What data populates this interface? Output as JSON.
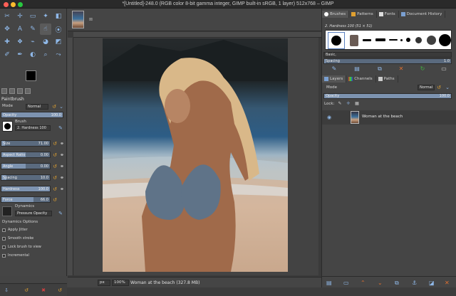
{
  "window": {
    "title": "*[Untitled]-248.0 (RGB color 8-bit gamma integer, GIMP built-in sRGB, 1 layer) 512x768 – GIMP",
    "traffic_colors": [
      "#ff5f57",
      "#febc2e",
      "#28c840"
    ]
  },
  "toolbox": {
    "tools": [
      "scissors-icon",
      "crosshair-icon",
      "rect-select-icon",
      "fuzzy-select-icon",
      "eraser-icon",
      "move-icon",
      "text-icon",
      "paintbrush-icon",
      "smudge-icon",
      "color-picker-icon",
      "heal-icon",
      "clone-icon",
      "warp-icon",
      "bucket-icon",
      "gradient-icon",
      "pencil-icon",
      "ink-icon",
      "dodge-icon",
      "zoom-icon",
      "path-icon"
    ],
    "glyphs": [
      "✂",
      "✛",
      "▭",
      "✦",
      "◧",
      "✥",
      "A",
      "✎",
      "☝",
      "⦿",
      "✚",
      "❖",
      "⌁",
      "◕",
      "◩",
      "✐",
      "✒",
      "◐",
      "⌕",
      "⤳"
    ],
    "active_index": 8
  },
  "tool_options": {
    "title": "Paintbrush",
    "mode_label": "Mode",
    "mode_value": "Normal",
    "opacity_label": "Opacity",
    "opacity_value": "100.0",
    "opacity_fraction": 1.0,
    "brush_label": "Brush",
    "brush_value": "2. Hardness 100",
    "size_label": "Size",
    "size_value": "71.00",
    "size_fraction": 0.07,
    "aspect_label": "Aspect Ratio",
    "aspect_value": "0.00",
    "aspect_fraction": 0.5,
    "angle_label": "Angle",
    "angle_value": "0.00",
    "angle_fraction": 0.5,
    "spacing_label": "Spacing",
    "spacing_value": "10.0",
    "spacing_fraction": 0.1,
    "hardness_label": "Hardness",
    "hardness_value": "100.0",
    "hardness_fraction": 1.0,
    "force_label": "Force",
    "force_value": "66.0",
    "force_fraction": 0.66,
    "dynamics_label": "Dynamics",
    "dynamics_value": "Pressure Opacity",
    "dynamics_options_label": "Dynamics Options",
    "checkboxes": [
      "Apply Jitter",
      "Smooth stroke",
      "Lock brush to view",
      "Incremental"
    ]
  },
  "statusbar": {
    "unit": "px",
    "zoom": "100%",
    "info": "Woman at the beach (327.8 MB)"
  },
  "brushes": {
    "tabs": [
      "Brushes",
      "Patterns",
      "Fonts",
      "Document History"
    ],
    "current_brush": "2. Hardness 100 (51 × 51)",
    "preset": "Basic,",
    "spacing_label": "Spacing",
    "spacing_value": "1.0"
  },
  "layers": {
    "tabs": [
      "Layers",
      "Channels",
      "Paths"
    ],
    "mode_label": "Mode",
    "mode_value": "Normal",
    "opacity_label": "Opacity",
    "opacity_value": "100.0",
    "lock_label": "Lock:",
    "layer_name": "Woman at the beach"
  }
}
